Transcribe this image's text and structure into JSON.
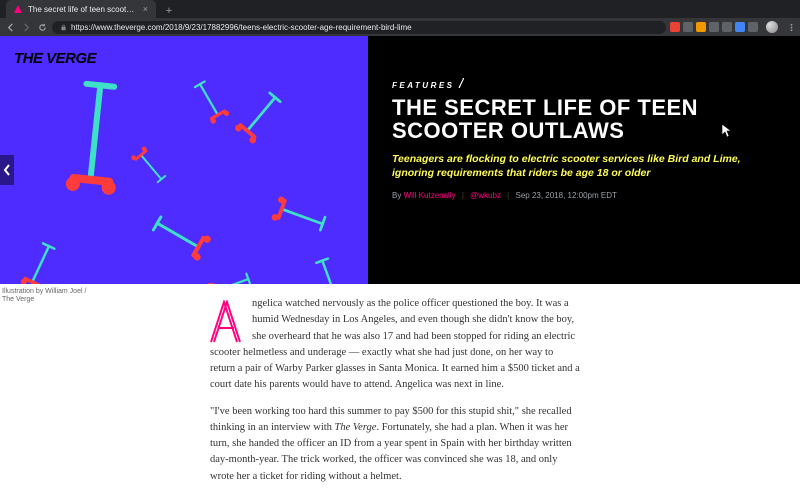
{
  "browser": {
    "tab_title": "The secret life of teen scooter …",
    "url": "https://www.theverge.com/2018/9/23/17882996/teens-electric-scooter-age-requirement-bird-lime",
    "new_tab_tooltip": "+"
  },
  "hero": {
    "logo": "THE VERGE",
    "kicker": "FEATURES",
    "headline": "THE SECRET LIFE OF TEEN SCOOTER OUTLAWS",
    "deck": "Teenagers are flocking to electric scooter services like Bird and Lime, ignoring requirements that riders be age 18 or older",
    "byline": {
      "by": "By",
      "author": "Will Kutzenally",
      "handle": "@wkubz",
      "timestamp": "Sep 23, 2018, 12:00pm EDT"
    },
    "caption": "Illustration by William Joel / The Verge"
  },
  "article": {
    "dropcap": "A",
    "p1": "ngelica watched nervously as the police officer questioned the boy. It was a humid Wednesday in Los Angeles, and even though she didn't know the boy, she overheard that he was also 17 and had been stopped for riding an electric scooter helmetless and underage — exactly what she had just done, on her way to return a pair of Warby Parker glasses in Santa Monica. It earned him a $500 ticket and a court date his parents would have to attend. Angelica was next in line.",
    "p2_pre": "\"I've been working too hard this summer to pay $500 for this stupid shit,\" she recalled thinking in an interview with ",
    "p2_em": "The Verge",
    "p2_post": ". Fortunately, she had a plan. When it was her turn, she handed the officer an ID from a year spent in Spain with her birthday written day-month-year. The trick worked, the officer was convinced she was 18, and only wrote her a ticket for riding without a helmet."
  },
  "colors": {
    "hero_bg": "#4e2bff",
    "accent_pink": "#ff0080",
    "accent_yellow": "#fefc55",
    "accent_teal": "#3fe0c8",
    "accent_red": "#ff3b3b"
  }
}
